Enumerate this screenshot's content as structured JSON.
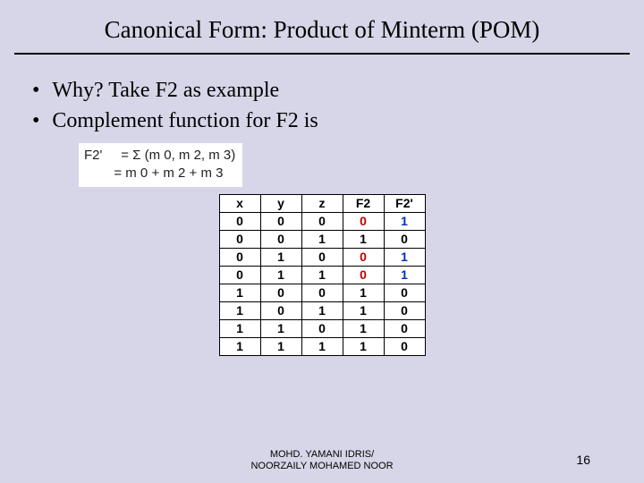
{
  "title": "Canonical Form: Product of Minterm (POM)",
  "bullets": [
    "Why? Take F2 as example",
    "Complement function for F2 is"
  ],
  "formula": {
    "lhs": "F2'",
    "line1": "= Σ (m 0, m 2, m 3)",
    "line2": "= m 0 + m 2 + m 3"
  },
  "chart_data": {
    "type": "table",
    "title": "Truth table for F2 and F2'",
    "columns": [
      "x",
      "y",
      "z",
      "F2",
      "F2'"
    ],
    "rows": [
      {
        "x": 0,
        "y": 0,
        "z": 0,
        "F2": 0,
        "F2p": 1
      },
      {
        "x": 0,
        "y": 0,
        "z": 1,
        "F2": 1,
        "F2p": 0
      },
      {
        "x": 0,
        "y": 1,
        "z": 0,
        "F2": 0,
        "F2p": 1
      },
      {
        "x": 0,
        "y": 1,
        "z": 1,
        "F2": 0,
        "F2p": 1
      },
      {
        "x": 1,
        "y": 0,
        "z": 0,
        "F2": 1,
        "F2p": 0
      },
      {
        "x": 1,
        "y": 0,
        "z": 1,
        "F2": 1,
        "F2p": 0
      },
      {
        "x": 1,
        "y": 1,
        "z": 0,
        "F2": 1,
        "F2p": 0
      },
      {
        "x": 1,
        "y": 1,
        "z": 1,
        "F2": 1,
        "F2p": 0
      }
    ]
  },
  "footer": {
    "author_line1": "MOHD. YAMANI IDRIS/",
    "author_line2": "NOORZAILY MOHAMED NOOR",
    "page": "16"
  }
}
